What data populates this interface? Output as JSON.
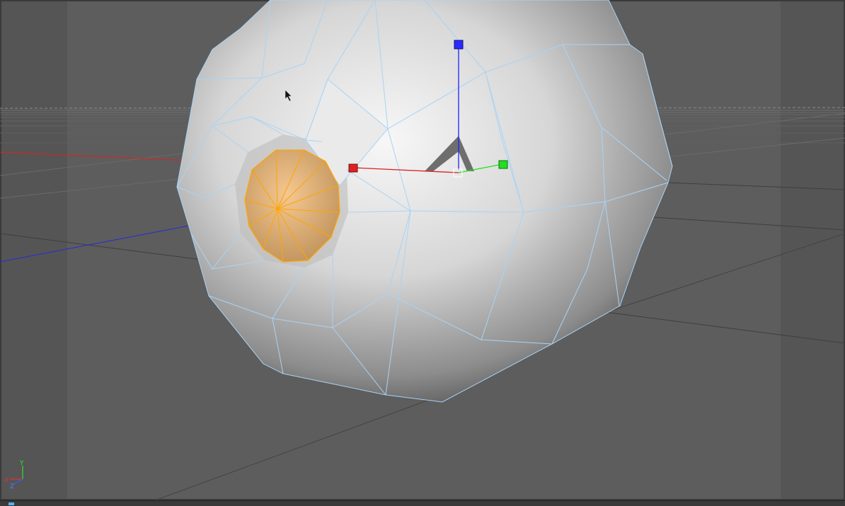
{
  "viewport": {
    "colors": {
      "background": "#5d5d5d",
      "safe_frame_overlay": "#555555",
      "horizon_grid": "#6a6a6a",
      "wireframe": "#a9d3f5",
      "selected_polygon": "#f0b055",
      "selected_edges": "#ffa500",
      "x_axis": "#e02020",
      "y_axis": "#20d020",
      "z_axis": "#2020e0"
    },
    "axis_indicator": {
      "x_label": "X",
      "y_label": "Y",
      "z_label": "Z"
    },
    "cursor": "arrow-cursor-icon",
    "gizmo": "move-gizmo-icon"
  }
}
